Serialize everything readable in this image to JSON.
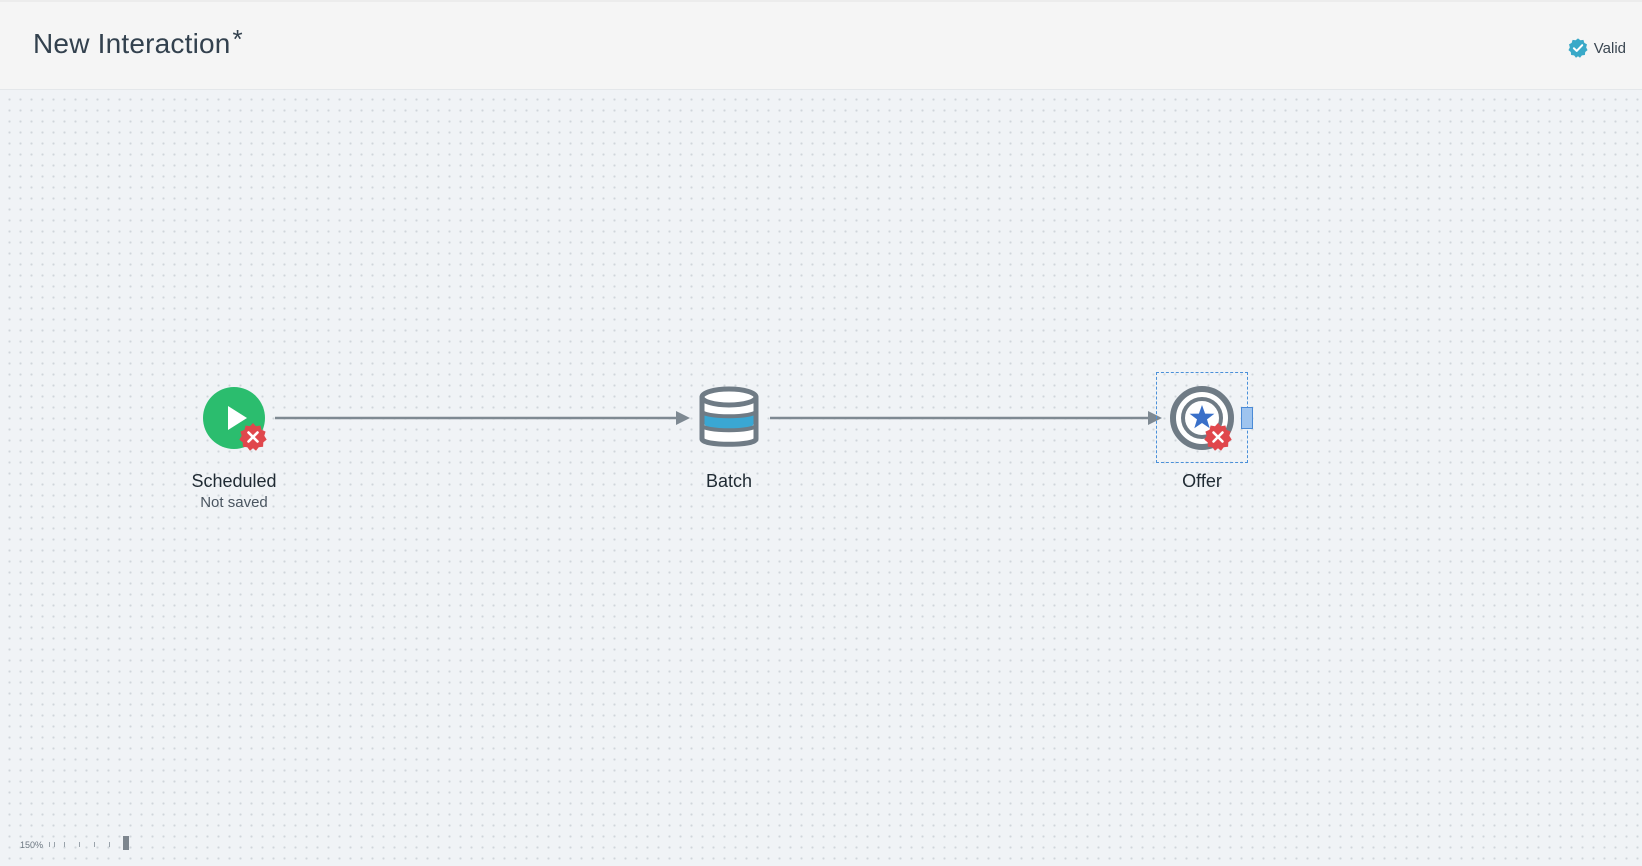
{
  "header": {
    "title": "New Interaction",
    "dirty_marker": "*",
    "status": {
      "label": "Valid",
      "icon": "verified-badge-icon",
      "color": "#39a9c8"
    }
  },
  "canvas": {
    "nodes": [
      {
        "id": "scheduled",
        "label": "Scheduled",
        "sublabel": "Not saved",
        "icon": "play-circle-icon",
        "icon_color": "#2bbd6e",
        "has_error": true
      },
      {
        "id": "batch",
        "label": "Batch",
        "icon": "database-icon",
        "icon_color": "#6f7b85",
        "accent_color": "#3aa7d3",
        "has_error": false
      },
      {
        "id": "offer",
        "label": "Offer",
        "icon": "target-star-icon",
        "icon_color": "#6f7b85",
        "accent_color": "#3a70c9",
        "has_error": true,
        "selected": true
      }
    ],
    "edges": [
      {
        "from": "scheduled",
        "to": "batch"
      },
      {
        "from": "batch",
        "to": "offer"
      }
    ],
    "error_color": "#e0474c",
    "edge_color": "#7e8992",
    "selection_color": "#4a90d9"
  },
  "zoom": {
    "label": "150%"
  }
}
